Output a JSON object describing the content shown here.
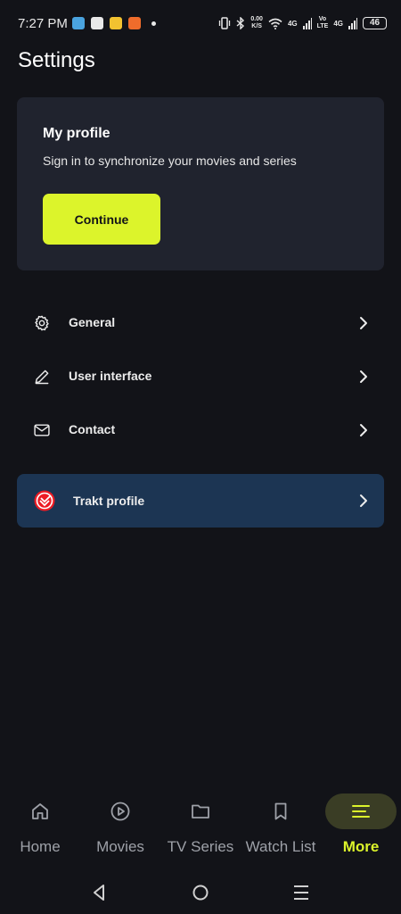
{
  "status_bar": {
    "time": "7:27 PM",
    "net_speed_value": "0.00",
    "net_speed_unit": "K/S",
    "signal_1": "4G",
    "signal_2_top": "Vo",
    "signal_2_bottom": "LTE",
    "signal_3": "4G",
    "battery": "46"
  },
  "header": {
    "title": "Settings"
  },
  "profile_card": {
    "title": "My profile",
    "subtitle": "Sign in to synchronize your movies and series",
    "button_label": "Continue"
  },
  "settings": {
    "items": [
      {
        "label": "General",
        "icon": "gear-icon"
      },
      {
        "label": "User interface",
        "icon": "pencil-icon"
      },
      {
        "label": "Contact",
        "icon": "mail-icon"
      }
    ],
    "trakt": {
      "label": "Trakt profile",
      "icon": "trakt-logo"
    }
  },
  "bottom_nav": {
    "items": [
      {
        "label": "Home",
        "icon": "home-icon"
      },
      {
        "label": "Movies",
        "icon": "play-circle-icon"
      },
      {
        "label": "TV Series",
        "icon": "folder-icon"
      },
      {
        "label": "Watch List",
        "icon": "bookmark-icon"
      },
      {
        "label": "More",
        "icon": "menu-icon",
        "active": true
      }
    ]
  },
  "colors": {
    "background": "#121318",
    "card": "#20232e",
    "accent": "#dcf42b",
    "trakt_row": "#1c3553",
    "inactive_nav": "#9ea1a8"
  }
}
